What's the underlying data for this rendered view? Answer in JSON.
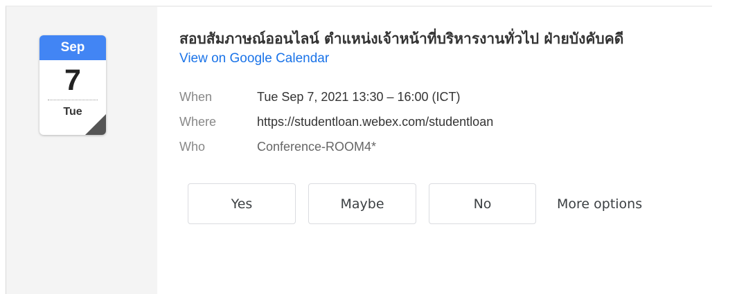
{
  "calendar_icon": {
    "month": "Sep",
    "day": "7",
    "weekday": "Tue"
  },
  "event": {
    "title": "สอบสัมภาษณ์ออนไลน์ ตำแหน่งเจ้าหน้าที่บริหารงานทั่วไป ฝ่ายบังคับคดี",
    "link_text": "View on Google Calendar",
    "details": [
      {
        "label": "When",
        "value": "Tue Sep 7, 2021 13:30 – 16:00 (ICT)"
      },
      {
        "label": "Where",
        "value": "https://studentloan.webex.com/studentloan"
      },
      {
        "label": "Who",
        "value": "Conference-ROOM4*"
      }
    ]
  },
  "rsvp": {
    "yes": "Yes",
    "maybe": "Maybe",
    "no": "No",
    "more": "More options"
  },
  "colors": {
    "accent": "#4285f4",
    "link": "#1a73e8"
  }
}
